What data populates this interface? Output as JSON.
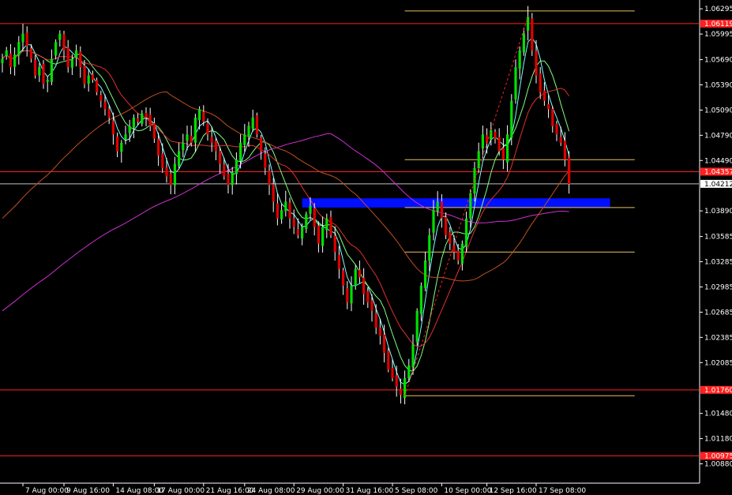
{
  "chart_data": {
    "type": "line",
    "subtype": "candlestick-forex",
    "title": "",
    "xlabel": "",
    "ylabel": "",
    "ylim": [
      1.0065,
      1.064
    ],
    "grid": false,
    "colors": {
      "background": "#000000",
      "bull": "#00e000",
      "bear": "#e00000",
      "wick": "#ffffff",
      "axis": "#ffffff",
      "ma_fast": "#7fffff",
      "ma_mid": "#80ff80",
      "ma_slow": "#e03030",
      "ma_100": "#c05020",
      "ma_200": "#d030d0",
      "level_red": "#ff2020",
      "level_gold": "#e8c060",
      "zone_blue": "#0010ff",
      "current_line": "#c0c0c0"
    },
    "y_ticks": [
      "1.06295",
      "1.05995",
      "1.05690",
      "1.05390",
      "1.05090",
      "1.04790",
      "1.04490",
      "1.03890",
      "1.03585",
      "1.03285",
      "1.02985",
      "1.02685",
      "1.02385",
      "1.02085",
      "1.01480",
      "1.01180",
      "1.00880"
    ],
    "y_tick_values": [
      1.06295,
      1.05995,
      1.0569,
      1.0539,
      1.0509,
      1.0479,
      1.0449,
      1.0389,
      1.03585,
      1.03285,
      1.02985,
      1.02685,
      1.02385,
      1.02085,
      1.0148,
      1.0118,
      1.0088
    ],
    "x_ticks": [
      "7 Aug 00:00",
      "9 Aug 16:00",
      "14 Aug 08:00",
      "17 Aug 00:00",
      "21 Aug 16:00",
      "24 Aug 08:00",
      "29 Aug 00:00",
      "31 Aug 16:00",
      "5 Sep 08:00",
      "10 Sep 00:00",
      "12 Sep 16:00",
      "17 Sep 08:00"
    ],
    "x_tick_index": [
      5,
      15,
      27,
      37,
      49,
      59,
      71,
      83,
      95,
      107,
      118,
      130
    ],
    "price_labels": [
      {
        "text": "1.06119",
        "value": 1.06119,
        "color": "red"
      },
      {
        "text": "1.04357",
        "value": 1.04357,
        "color": "red"
      },
      {
        "text": "1.04212",
        "value": 1.04212,
        "color": "white"
      },
      {
        "text": "1.01760",
        "value": 1.0176,
        "color": "red"
      },
      {
        "text": "1.00975",
        "value": 1.00975,
        "color": "red"
      }
    ],
    "horizontal_levels": [
      {
        "value": 1.06119,
        "color": "red",
        "x_from": 0
      },
      {
        "value": 1.04357,
        "color": "red",
        "x_from": 0
      },
      {
        "value": 1.04212,
        "color": "white",
        "x_from": 0
      },
      {
        "value": 1.0176,
        "color": "red",
        "x_from": 0
      },
      {
        "value": 1.00975,
        "color": "red",
        "x_from": 0
      }
    ],
    "fib_levels": [
      1.0627,
      1.045,
      1.0393,
      1.034,
      1.0169
    ],
    "fib_x_start_index": 98,
    "fib_x_end_index": 154,
    "demand_zone": {
      "low": 1.0393,
      "high": 1.0404,
      "x_start_index": 73,
      "x_end_index": 148
    },
    "trend_line": {
      "from_index": 98,
      "from_value": 1.0169,
      "to_index": 128,
      "to_value": 1.062
    },
    "closes": [
      1.057,
      1.058,
      1.056,
      1.0575,
      1.059,
      1.06,
      1.0585,
      1.057,
      1.055,
      1.056,
      1.054,
      1.0545,
      1.057,
      1.059,
      1.06,
      1.058,
      1.056,
      1.057,
      1.058,
      1.056,
      1.054,
      1.055,
      1.0545,
      1.053,
      1.052,
      1.051,
      1.05,
      1.048,
      1.046,
      1.047,
      1.048,
      1.049,
      1.05,
      1.0495,
      1.0505,
      1.05,
      1.049,
      1.0475,
      1.0455,
      1.044,
      1.043,
      1.042,
      1.0445,
      1.046,
      1.047,
      1.048,
      1.047,
      1.05,
      1.051,
      1.0495,
      1.048,
      1.047,
      1.046,
      1.0445,
      1.043,
      1.042,
      1.0435,
      1.045,
      1.047,
      1.048,
      1.049,
      1.05,
      1.048,
      1.046,
      1.044,
      1.042,
      1.04,
      1.038,
      1.039,
      1.04,
      1.038,
      1.037,
      1.036,
      1.037,
      1.0385,
      1.0395,
      1.037,
      1.035,
      1.037,
      1.038,
      1.036,
      1.034,
      1.032,
      1.03,
      1.028,
      1.03,
      1.032,
      1.031,
      1.029,
      1.028,
      1.027,
      1.025,
      1.024,
      1.022,
      1.02,
      1.019,
      1.018,
      1.017,
      1.019,
      1.0205,
      1.023,
      1.027,
      1.03,
      1.033,
      1.036,
      1.039,
      1.04,
      1.038,
      1.036,
      1.035,
      1.034,
      1.033,
      1.035,
      1.038,
      1.041,
      1.044,
      1.046,
      1.048,
      1.047,
      1.0485,
      1.0475,
      1.046,
      1.045,
      1.048,
      1.052,
      1.056,
      1.058,
      1.06,
      1.062,
      1.058,
      1.055,
      1.053,
      1.052,
      1.051,
      1.049,
      1.048,
      1.047,
      1.045,
      1.0421
    ]
  }
}
